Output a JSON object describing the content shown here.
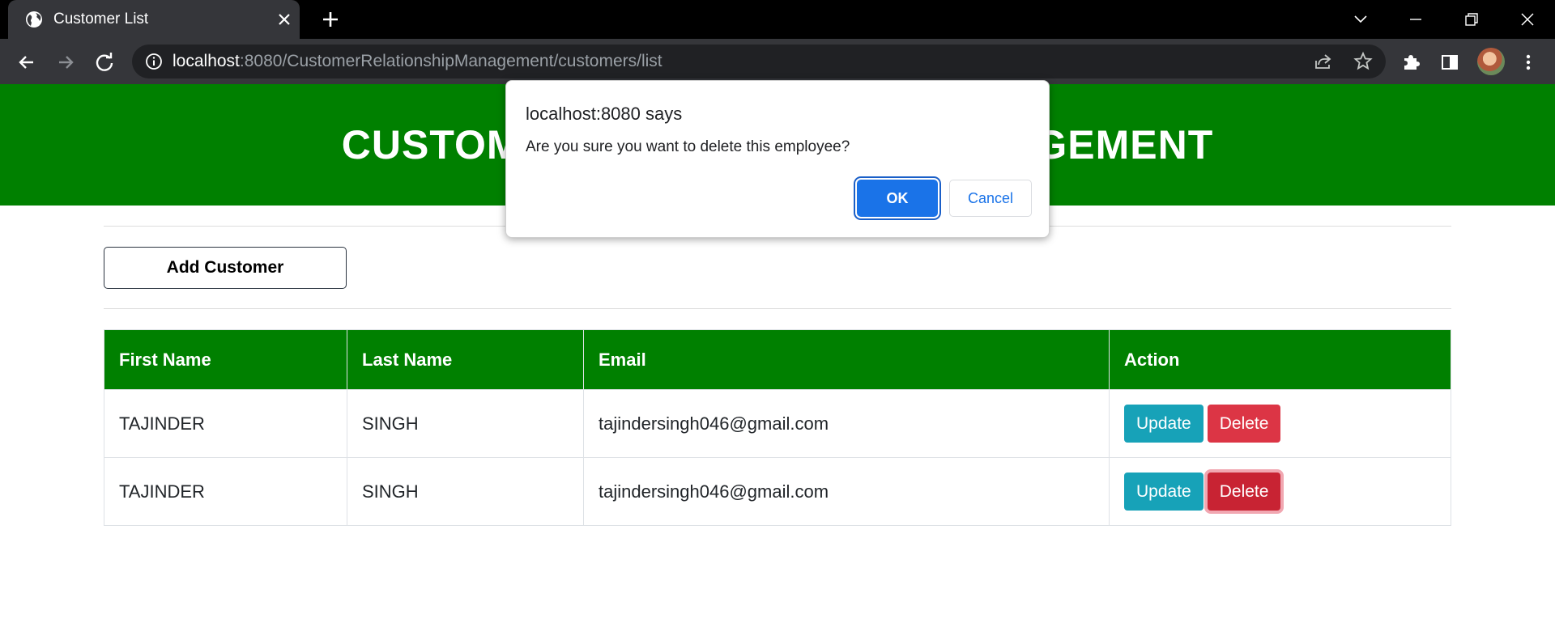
{
  "browser": {
    "tab_title": "Customer List",
    "url_host": "localhost",
    "url_rest": ":8080/CustomerRelationshipManagement/customers/list"
  },
  "page": {
    "header_title": "CUSTOMER RELATIONSHIP MANAGEMENT",
    "add_button": "Add Customer",
    "table": {
      "headers": [
        "First Name",
        "Last Name",
        "Email",
        "Action"
      ],
      "rows": [
        {
          "first": "TAJINDER",
          "last": "SINGH",
          "email": "tajindersingh046@gmail.com",
          "update": "Update",
          "delete": "Delete"
        },
        {
          "first": "TAJINDER",
          "last": "SINGH",
          "email": "tajindersingh046@gmail.com",
          "update": "Update",
          "delete": "Delete"
        }
      ]
    }
  },
  "dialog": {
    "origin": "localhost:8080 says",
    "message": "Are you sure you want to delete this employee?",
    "ok_label": "OK",
    "cancel_label": "Cancel"
  },
  "colors": {
    "header_green": "#008000",
    "update_button": "#17a2b8",
    "delete_button": "#dc3545",
    "dialog_ok": "#1a73e8"
  },
  "icons": [
    "globe-icon",
    "close-icon",
    "plus-icon",
    "chevron-down-icon",
    "minimize-icon",
    "restore-icon",
    "back-arrow-icon",
    "forward-arrow-icon",
    "reload-icon",
    "info-icon",
    "share-icon",
    "star-icon",
    "puzzle-icon",
    "sidepanel-icon",
    "kebab-menu-icon"
  ]
}
